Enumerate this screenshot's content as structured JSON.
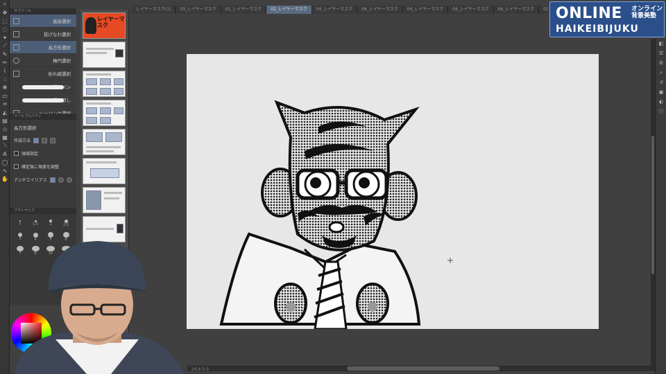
{
  "tabs": [
    {
      "label": "レイヤーマスク(1)"
    },
    {
      "label": "03_レイヤーマスク"
    },
    {
      "label": "01_レイヤーマスク"
    },
    {
      "label": "02_レイヤーマスク",
      "active": true
    },
    {
      "label": "04_レイヤーマスク"
    },
    {
      "label": "04_レイヤーマスク"
    },
    {
      "label": "04_レイヤーマスク"
    },
    {
      "label": "04_レイヤーマスク"
    },
    {
      "label": "04_レイヤーマスク"
    },
    {
      "label": "01_レイヤーマスク"
    }
  ],
  "logo": {
    "line1": "ONLINE",
    "jp_top": "オンライン",
    "jp_bottom": "背景美塾",
    "line2": "HAIKEIBIJUKU",
    "bg_color": "#2a4f8a"
  },
  "subtool": {
    "header": "サブツール",
    "items": [
      {
        "label": "直接選択",
        "selected": true
      },
      {
        "label": "投げなわ選択"
      },
      {
        "label": "長方形選択",
        "selected": true
      },
      {
        "label": "楕円選択"
      },
      {
        "label": "折れ線選択"
      },
      {
        "label": "選択ペン"
      },
      {
        "label": "選択消し"
      },
      {
        "label": "シュリンク選択"
      }
    ]
  },
  "toolprop": {
    "header": "ツールプロパティ",
    "title": "長方形選択",
    "row1_label": "作成方法",
    "row2_label": "領域指定",
    "row3_label": "確定後に角度を調整",
    "row4_label": "アンチエイリアス"
  },
  "brushsize": {
    "header": "ブラシサイズ",
    "sizes": [
      "1",
      "1.5",
      "2",
      "2.5",
      "3",
      "4",
      "5",
      "6",
      "7",
      "8",
      "10",
      "12"
    ]
  },
  "pages": {
    "cover_title": "レイヤーマスク"
  },
  "status": {
    "text": "26.6  0.0"
  },
  "colors": {
    "accent": "#4d5e78",
    "canvas_bg": "#e6e7e6",
    "logo_bg": "#2a4f8a"
  }
}
